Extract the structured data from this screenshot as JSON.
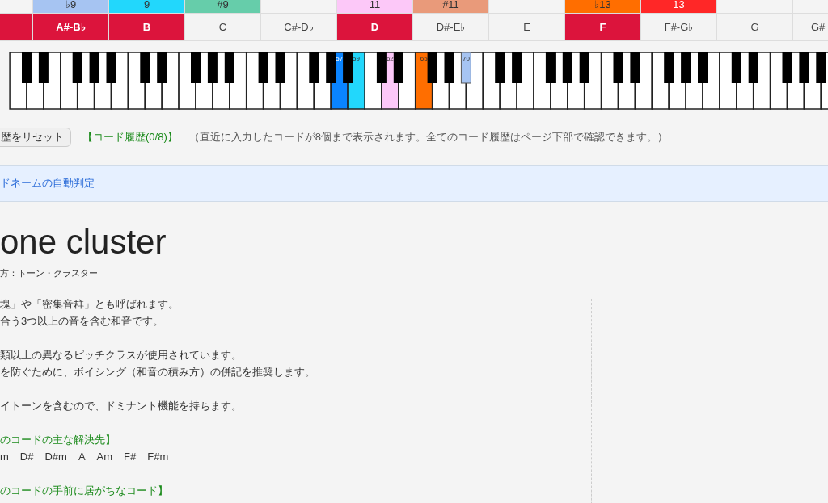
{
  "columns": [
    {
      "note": {
        "selected": true
      }
    },
    {
      "interval": {
        "label": "♭9",
        "color": "#a6c4f2"
      },
      "note": {
        "label": "A#-B♭",
        "selected": true
      }
    },
    {
      "interval": {
        "label": "9",
        "color": "#22d7fc"
      },
      "note": {
        "label": "B",
        "selected": true
      }
    },
    {
      "interval": {
        "label": "#9",
        "color": "#66cdaa"
      },
      "note": {
        "label": "C",
        "selected": false
      }
    },
    {
      "note": {
        "label": "C#-D♭",
        "selected": false
      }
    },
    {
      "interval": {
        "label": "11",
        "color": "#fcc8f8"
      },
      "note": {
        "label": "D",
        "selected": true
      }
    },
    {
      "interval": {
        "label": "#11",
        "color": "#e99a7a"
      },
      "note": {
        "label": "D#-E♭",
        "selected": false
      }
    },
    {
      "note": {
        "label": "E",
        "selected": false
      }
    },
    {
      "interval": {
        "label": "♭13",
        "color": "#ff6e00"
      },
      "note": {
        "label": "F",
        "selected": true
      }
    },
    {
      "interval": {
        "label": "13",
        "color": "#ff2727"
      },
      "note": {
        "label": "F#-G♭",
        "selected": false
      }
    },
    {
      "note": {
        "label": "G",
        "selected": false
      }
    },
    {
      "note": {
        "label": "G#",
        "selected": false
      }
    }
  ],
  "keyboard": {
    "highlighted": [
      {
        "label": "57",
        "color": "#0a84ff"
      },
      {
        "label": "59",
        "color": "#22d7fc"
      },
      {
        "label": "62",
        "color": "#fcc8f8"
      },
      {
        "label": "65",
        "color": "#ff6e00"
      },
      {
        "label": "70",
        "color": "#a6c4f2"
      }
    ]
  },
  "history": {
    "reset_button": "歴をリセット",
    "title": "【コード履歴(0/8)】",
    "note": "（直近に入力したコードが8個まで表示されます。全てのコード履歴はページ下部で確認できます。）"
  },
  "auto_detect": {
    "label": "ドネームの自動判定"
  },
  "chord": {
    "name": "one cluster",
    "reading": "方：トーン・クラスター",
    "paragraphs": [
      [
        "塊」や「密集音群」とも呼ばれます。",
        "合う3つ以上の音を含む和音です。"
      ],
      [
        "類以上の異なるピッチクラスが使用されています。",
        "を防ぐために、ボイシング（和音の積み方）の併記を推奨します。"
      ],
      [
        "イトーンを含むので、ドミナント機能を持ちます。"
      ]
    ],
    "resolutions": {
      "heading": "のコードの主な解決先】",
      "chords": [
        "m",
        "D#",
        "D#m",
        "A",
        "Am",
        "F#",
        "F#m"
      ]
    },
    "preceding": {
      "heading": "のコードの手前に居がちなコード】"
    }
  }
}
